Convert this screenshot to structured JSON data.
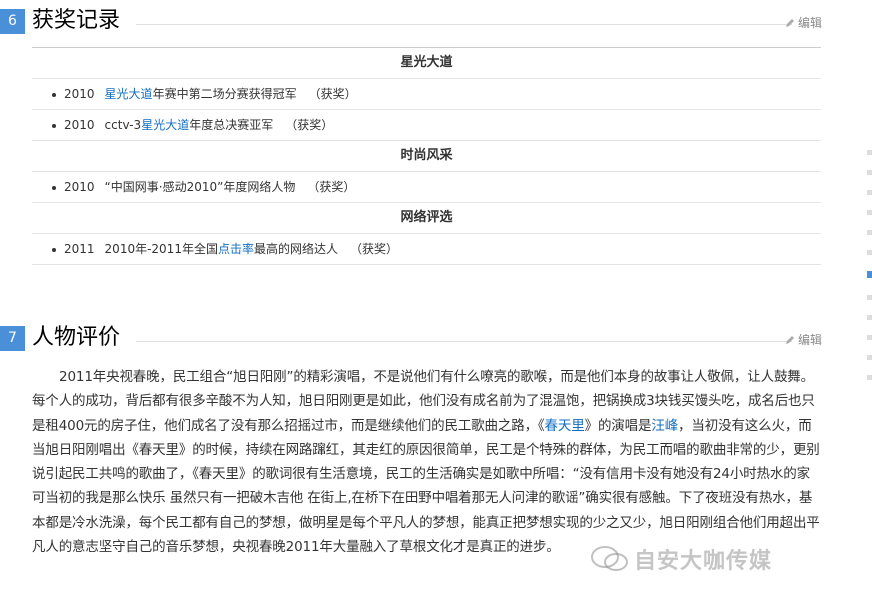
{
  "sections": {
    "awards": {
      "num": "6",
      "title": "获奖记录",
      "edit": "编辑"
    },
    "review": {
      "num": "7",
      "title": "人物评价",
      "edit": "编辑"
    }
  },
  "awards": {
    "cat1": "星光大道",
    "r1": {
      "year": "2010",
      "link": "星光大道",
      "rest": "年赛中第二场分赛获得冠军",
      "badge": "（获奖）"
    },
    "r2": {
      "year": "2010",
      "pre": "cctv-3",
      "link": "星光大道",
      "rest": "年度总决赛亚军",
      "badge": "（获奖）"
    },
    "cat2": "时尚风采",
    "r3": {
      "year": "2010",
      "text": "“中国网事·感动2010”年度网络人物",
      "badge": "（获奖）"
    },
    "cat3": "网络评选",
    "r4": {
      "year": "2011",
      "pre": "2010年-2011年全国",
      "link": "点击率",
      "rest": "最高的网络达人",
      "badge": "（获奖）"
    }
  },
  "review": {
    "t1": "2011年央视春晚，民工组合“旭日阳刚”的精彩演唱，不是说他们有什么嘹亮的歌喉，而是他们本身的故事让人敬佩，让人鼓舞。每个人的成功，背后都有很多辛酸不为人知，旭日阳刚更是如此，他们没有成名前为了混温饱，把锅换成3块钱买馒头吃，成名后也只是租400元的房子住，他们成名了没有那么招摇过市，而是继续他们的民工歌曲之路，《",
    "link1": "春天里",
    "t2": "》的演唱是",
    "link2": "汪峰",
    "t3": "，当初没有这么火，而当旭日阳刚唱出《春天里》的时候，持续在网路蹿红，其走红的原因很简单，民工是个特殊的群体，为民工而唱的歌曲非常的少，更别说引起民工共鸣的歌曲了，《春天里》的歌词很有生活意境，民工的生活确实是如歌中所唱：“没有信用卡没有她没有24小时热水的家  可当初的我是那么快乐  虽然只有一把破木吉他  在街上,在桥下在田野中唱着那无人问津的歌谣”确实很有感触。下了夜班没有热水，基本都是冷水洗澡，每个民工都有自己的梦想，做明星是每个平凡人的梦想，能真正把梦想实现的少之又少，旭日阳刚组合他们用超出平凡人的意志坚守自己的音乐梦想，央视春晚2011年大量融入了草根文化才是真正的进步。"
  },
  "watermark": "自安大咖传媒",
  "colors": {
    "accent": "#4a90d9",
    "link": "#136ec2"
  }
}
